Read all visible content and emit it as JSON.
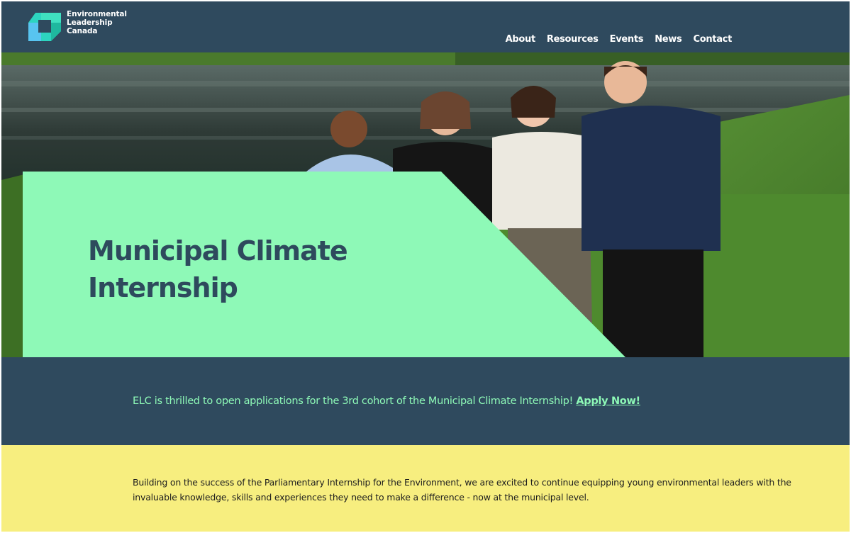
{
  "brand": {
    "name_lines": [
      "Environmental",
      "Leadership",
      "Canada"
    ],
    "colors": {
      "navy": "#2f4a5e",
      "mint": "#8ef9b7",
      "yellow": "#f7ee7f",
      "teal": "#2dd4bf"
    }
  },
  "nav": {
    "items": [
      {
        "label": "About"
      },
      {
        "label": "Resources"
      },
      {
        "label": "Events"
      },
      {
        "label": "News"
      },
      {
        "label": "Contact"
      }
    ]
  },
  "hero": {
    "title_line1": "Municipal Climate",
    "title_line2": "Internship",
    "image_description": "group photo icon"
  },
  "announcement": {
    "text": "ELC is thrilled to open applications for the 3rd cohort of the Municipal Climate Internship! ",
    "link_label": "Apply Now!"
  },
  "intro": {
    "text": "Building on the success of the Parliamentary Internship for the Environment, we are excited to continue equipping young environmental leaders with the invaluable knowledge, skills and experiences they need to make a difference - now at the municipal level."
  }
}
